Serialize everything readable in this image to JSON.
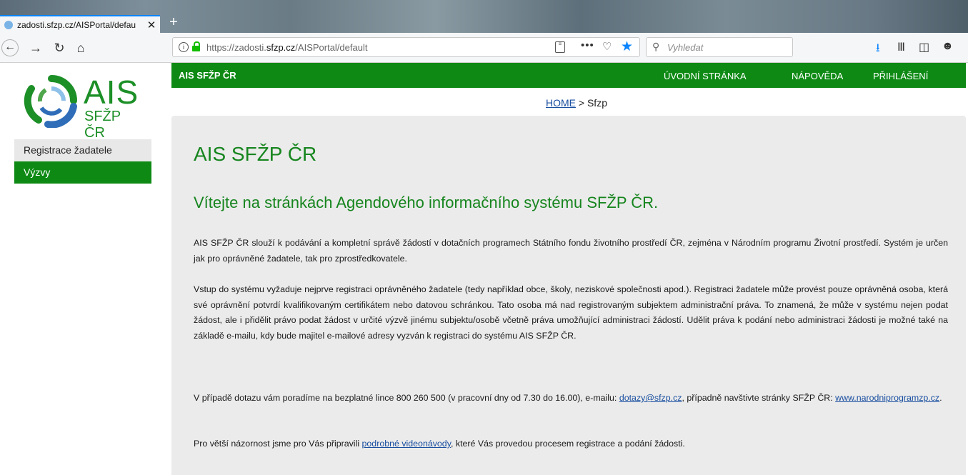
{
  "browser": {
    "tab_title": "zadosti.sfzp.cz/AISPortal/defau",
    "tab_close": "✕",
    "new_tab": "+",
    "url_prefix": "https://zadosti.",
    "url_domain": "sfzp.cz",
    "url_path": "/AISPortal/default",
    "search_placeholder": "Vyhledat"
  },
  "logo": {
    "title": "AIS",
    "subtitle": "SFŽP ČR"
  },
  "sidebar": {
    "items": [
      {
        "label": "Registrace žadatele"
      },
      {
        "label": "Výzvy"
      }
    ]
  },
  "topnav": {
    "brand": "AIS SFŽP ČR",
    "links": [
      "ÚVODNÍ STRÁNKA",
      "NÁPOVĚDA",
      "PŘIHLÁŠENÍ"
    ]
  },
  "breadcrumb": {
    "home": "HOME",
    "separator": ">",
    "current": "Sfzp"
  },
  "main": {
    "title": "AIS SFŽP ČR",
    "subtitle": "Vítejte na stránkách Agendového informačního systému SFŽP ČR.",
    "p1": "AIS SFŽP ČR slouží k podávání a kompletní správě žádostí v dotačních programech Státního fondu životního prostředí ČR, zejména v Národním programu Životní prostředí. Systém je určen jak pro oprávněné žadatele, tak pro zprostředkovatele.",
    "p2": "Vstup do systému vyžaduje nejprve registraci oprávněného žadatele (tedy například obce, školy, neziskové společnosti apod.). Registraci žadatele může provést pouze oprávněná osoba, která své oprávnění potvrdí kvalifikovaným certifikátem nebo datovou schránkou. Tato osoba má nad registrovaným subjektem administrační práva. To znamená, že může v systému nejen podat žádost, ale i přidělit právo podat žádost v určité výzvě jinému subjektu/osobě včetně práva umožňující administraci žádostí. Udělit práva k podání nebo administraci žádosti je možné také na základě e-mailu, kdy bude majitel e-mailové adresy vyzván k registraci do systému AIS SFŽP ČR.",
    "p3_a": "V případě dotazu vám poradíme na bezplatné lince 800 260 500 (v pracovní dny od 7.30 do 16.00), e-mailu: ",
    "p3_email": "dotazy@sfzp.cz",
    "p3_b": ", případně navštivte stránky SFŽP ČR: ",
    "p3_web": "www.narodniprogramzp.cz",
    "p3_c": ".",
    "p4_a": "Pro větší názornost jsme pro Vás připravili ",
    "p4_link": "podrobné videonávody",
    "p4_b": ", které Vás provedou procesem registrace a podání žádosti."
  },
  "colors": {
    "brand_green": "#0e8a14",
    "heading_green": "#16851e",
    "content_bg": "#ebebeb",
    "link": "#1a4fa0"
  }
}
